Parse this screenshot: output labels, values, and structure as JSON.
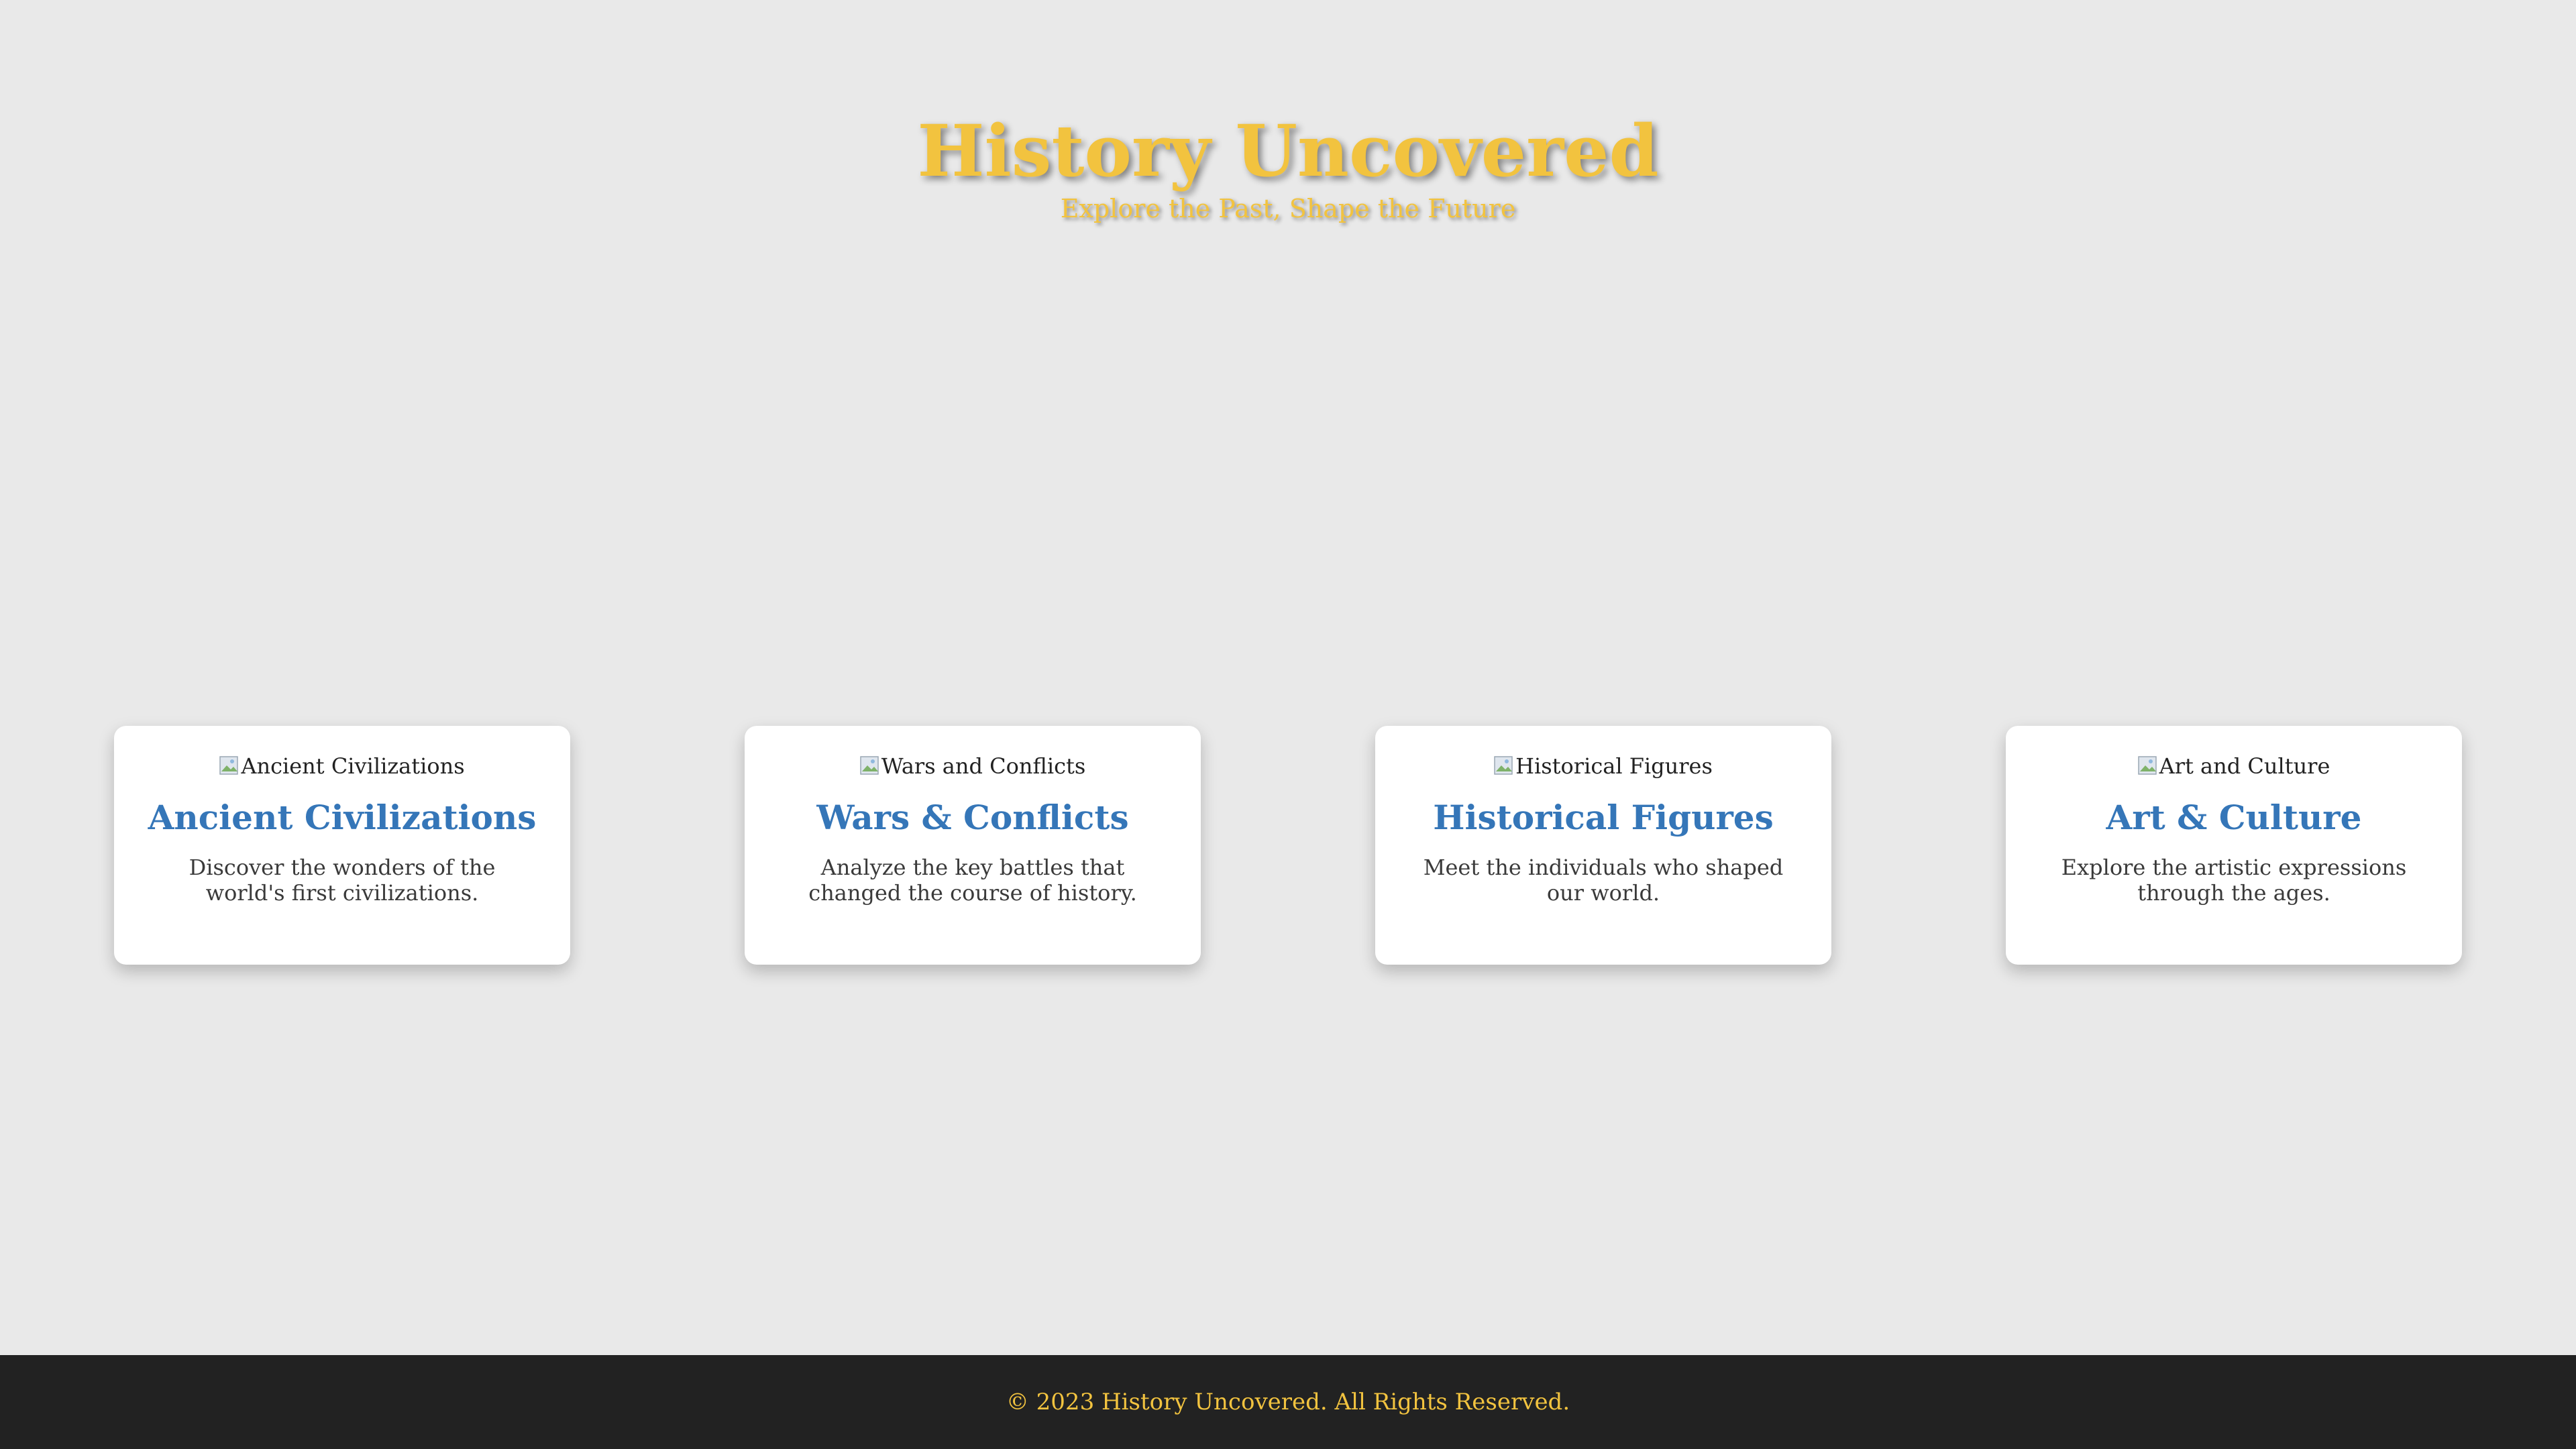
{
  "header": {
    "title": "History Uncovered",
    "subtitle": "Explore the Past, Shape the Future"
  },
  "cards": [
    {
      "image_alt": "Ancient Civilizations",
      "title": "Ancient Civilizations",
      "description": "Discover the wonders of the world's first civilizations."
    },
    {
      "image_alt": "Wars and Conflicts",
      "title": "Wars & Conflicts",
      "description": "Analyze the key battles that changed the course of history."
    },
    {
      "image_alt": "Historical Figures",
      "title": "Historical Figures",
      "description": "Meet the individuals who shaped our world."
    },
    {
      "image_alt": "Art and Culture",
      "title": "Art & Culture",
      "description": "Explore the artistic expressions through the ages."
    }
  ],
  "footer": {
    "copyright": "© 2023 History Uncovered. All Rights Reserved."
  },
  "colors": {
    "background": "#e9e9e9",
    "accent_gold": "#f2c33f",
    "card_title_blue": "#3576b8",
    "footer_bg": "#222222"
  },
  "icons": {
    "card_image": "broken-image-icon"
  }
}
